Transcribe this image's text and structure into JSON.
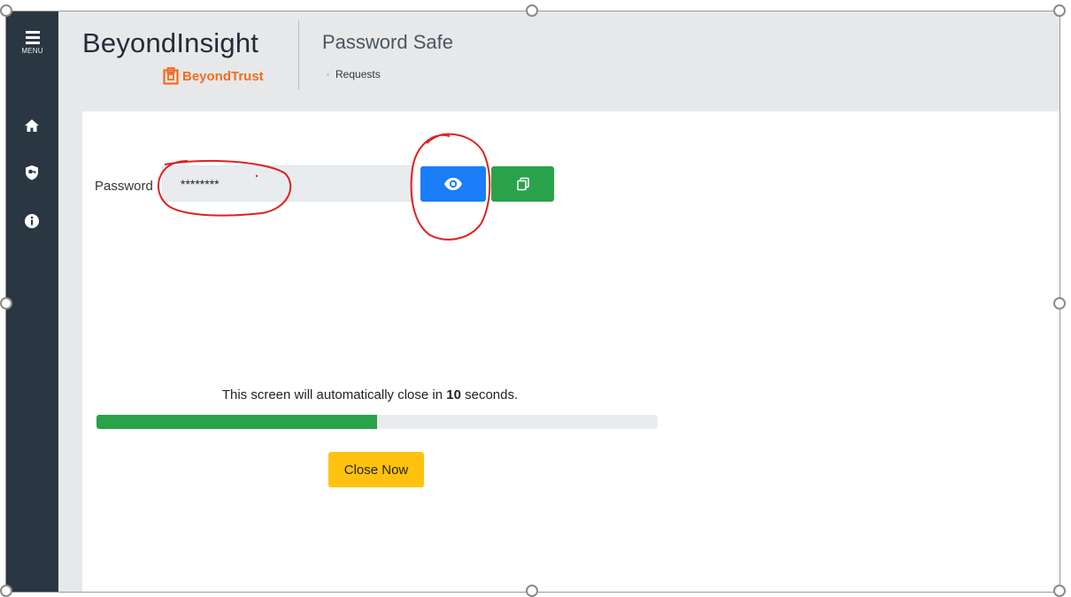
{
  "sidebar": {
    "menu_label": "MENU",
    "icons": [
      "home-icon",
      "shield-key-icon",
      "info-icon"
    ]
  },
  "header": {
    "brand": "BeyondInsight",
    "logo_text": "BeyondTrust",
    "app_title": "Password Safe",
    "breadcrumb": "Requests"
  },
  "password": {
    "label": "Password",
    "value": "********",
    "reveal_icon": "eye-icon",
    "copy_icon": "copy-icon"
  },
  "countdown": {
    "prefix": "This screen will automatically close in ",
    "seconds": "10",
    "suffix": " seconds.",
    "progress_fraction": 0.5
  },
  "close_button": "Close Now",
  "colors": {
    "sidebar": "#2a3743",
    "reveal_button": "#1b7df8",
    "copy_button": "#2aa24a",
    "close_button": "#ffc20e",
    "brand_orange": "#f26d21",
    "progress": "#2aa24a",
    "annotation": "#e01f1f"
  }
}
